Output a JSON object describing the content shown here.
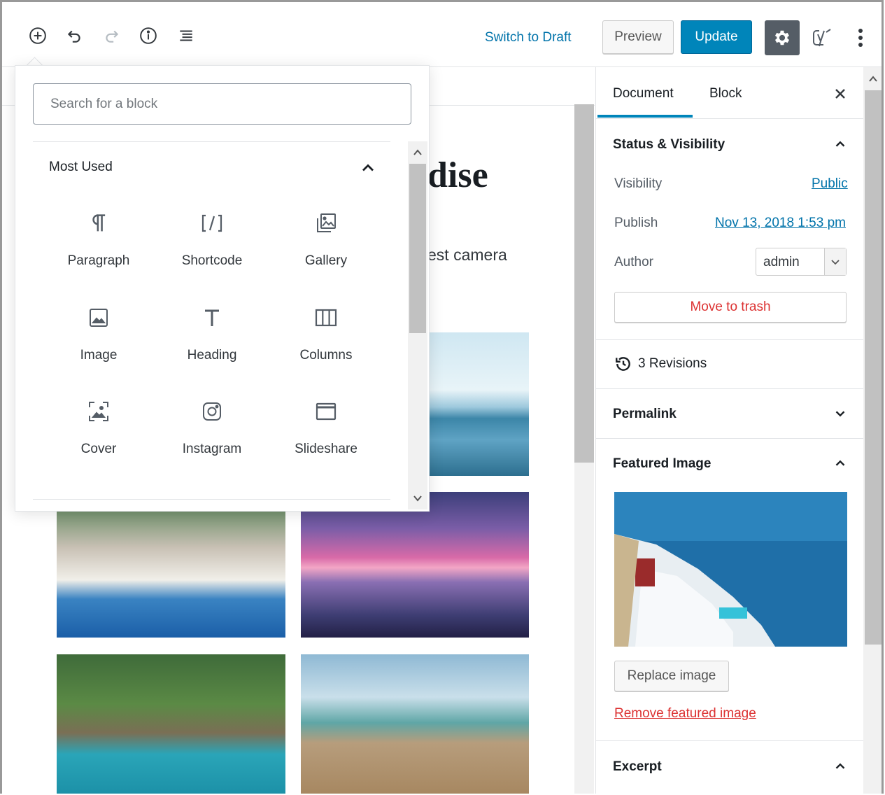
{
  "toolbar": {
    "icons": [
      "add-block-icon",
      "undo-icon",
      "redo-icon",
      "info-icon",
      "outline-icon"
    ],
    "switch_to_draft": "Switch to Draft",
    "preview": "Preview",
    "update": "Update",
    "accent": "#0085ba"
  },
  "editor": {
    "title_fragment": "dise",
    "paragraph_fragment": "est camera"
  },
  "inserter": {
    "search_placeholder": "Search for a block",
    "panel_title": "Most Used",
    "blocks": [
      {
        "label": "Paragraph",
        "icon": "paragraph-icon"
      },
      {
        "label": "Shortcode",
        "icon": "shortcode-icon"
      },
      {
        "label": "Gallery",
        "icon": "gallery-icon"
      },
      {
        "label": "Image",
        "icon": "image-icon"
      },
      {
        "label": "Heading",
        "icon": "heading-icon"
      },
      {
        "label": "Columns",
        "icon": "columns-icon"
      },
      {
        "label": "Cover",
        "icon": "cover-icon"
      },
      {
        "label": "Instagram",
        "icon": "instagram-icon"
      },
      {
        "label": "Slideshare",
        "icon": "slideshare-icon"
      }
    ]
  },
  "sidebar": {
    "tabs": {
      "document": "Document",
      "block": "Block"
    },
    "status": {
      "title": "Status & Visibility",
      "visibility_label": "Visibility",
      "visibility_value": "Public",
      "publish_label": "Publish",
      "publish_value": "Nov 13, 2018 1:53 pm",
      "author_label": "Author",
      "author_value": "admin",
      "trash": "Move to trash"
    },
    "revisions": "3 Revisions",
    "permalink": "Permalink",
    "featured": {
      "title": "Featured Image",
      "replace": "Replace image",
      "remove": "Remove featured image"
    },
    "excerpt": "Excerpt"
  }
}
